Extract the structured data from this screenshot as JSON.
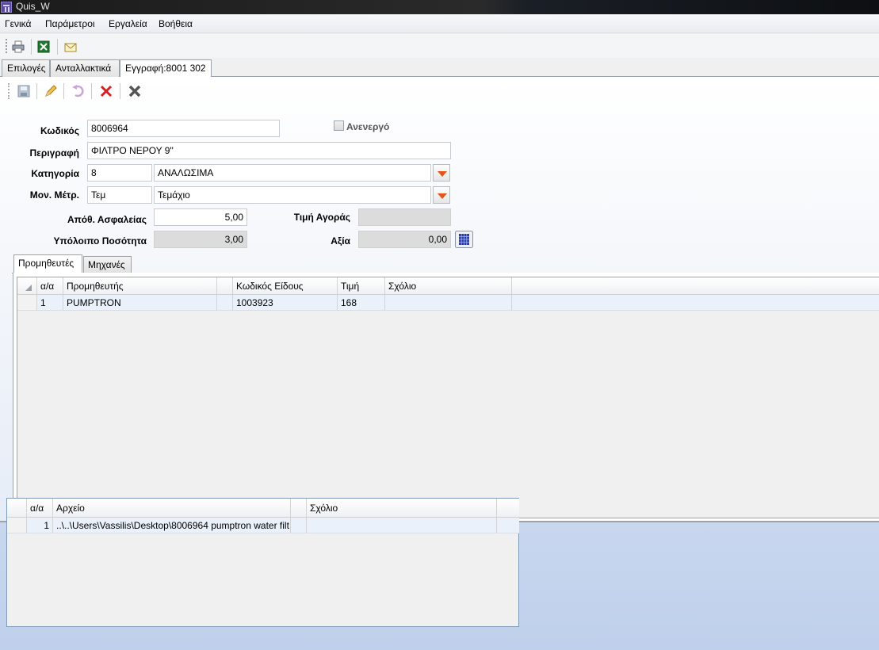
{
  "window": {
    "title": "Quis_W"
  },
  "menu": [
    "Γενικά",
    "Παράμετροι",
    "Εργαλεία",
    "Βοήθεια"
  ],
  "toolbar": {
    "icons": [
      "printer-icon",
      "excel-icon",
      "mail-icon"
    ]
  },
  "tabs": [
    "Επιλογές",
    "Ανταλλακτικά",
    "Εγγραφή:8001 302"
  ],
  "record_toolbar": {
    "icons": [
      "save-icon",
      "edit-icon",
      "undo-icon",
      "delete-icon",
      "close-icon"
    ]
  },
  "form": {
    "code_label": "Κωδικός",
    "code_value": "8006964",
    "inactive_label": "Ανενεργό",
    "inactive_checked": false,
    "description_label": "Περιγραφή",
    "description_value": "ΦΙΛΤΡΟ ΝΕΡΟΥ 9\"",
    "category_label": "Κατηγορία",
    "category_code": "8",
    "category_name": "ΑΝΑΛΩΣΙΜΑ",
    "unit_label": "Μον. Μέτρ.",
    "unit_code": "Τεμ",
    "unit_name": "Τεμάχιο",
    "safety_stock_label": "Απόθ. Ασφαλείας",
    "safety_stock_value": "5,00",
    "purchase_price_label": "Τιμή Αγοράς",
    "purchase_price_value": "",
    "remaining_qty_label": "Υπόλοιπο Ποσότητα",
    "remaining_qty_value": "3,00",
    "value_label": "Αξία",
    "value_value": "0,00"
  },
  "inner_tabs": [
    "Προμηθευτές",
    "Μηχανές"
  ],
  "suppliers_grid": {
    "columns": [
      "α/α",
      "Προμηθευτής",
      "Κωδικός Είδους",
      "Τιμή",
      "Σχόλιο"
    ],
    "rows": [
      {
        "aa": "1",
        "supplier": "PUMPTRON",
        "item_code": "1003923",
        "price": "168",
        "comment": ""
      }
    ]
  },
  "files_grid": {
    "columns": [
      "α/α",
      "Αρχείο",
      "Σχόλιο"
    ],
    "rows": [
      {
        "aa": "1",
        "file": "..\\..\\Users\\Vassilis\\Desktop\\8006964 pumptron water filt",
        "comment": ""
      }
    ]
  }
}
